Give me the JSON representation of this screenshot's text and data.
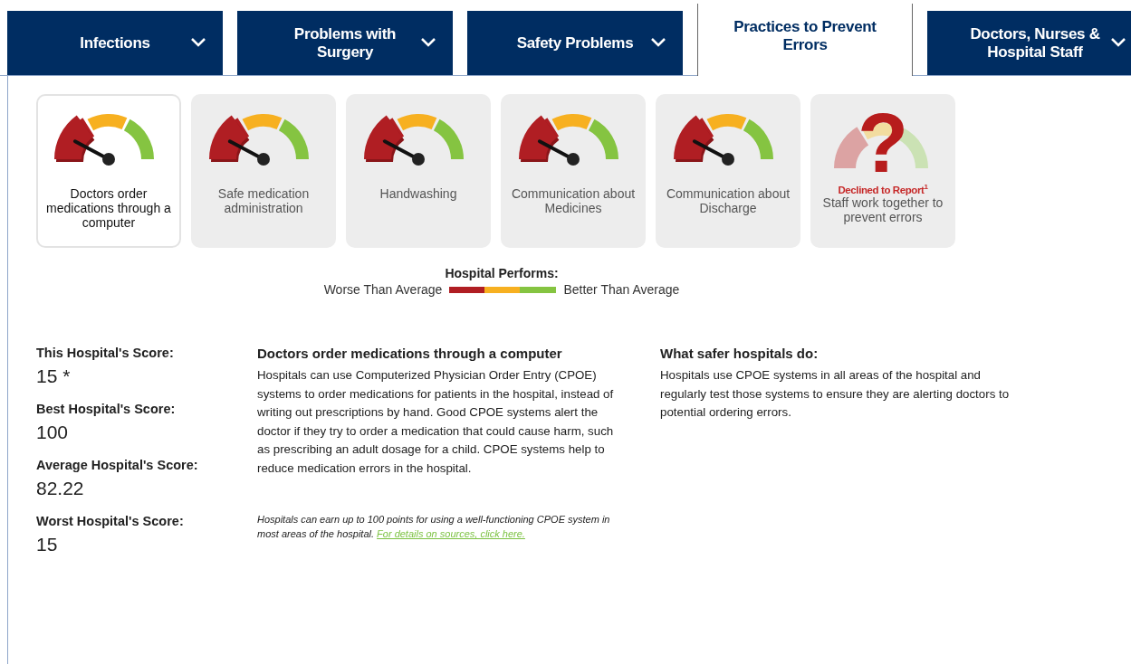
{
  "tabs": [
    {
      "label": "Infections",
      "selected": false
    },
    {
      "label": "Problems with Surgery",
      "selected": false
    },
    {
      "label": "Safety Problems",
      "selected": false
    },
    {
      "label": "Practices to Prevent Errors",
      "selected": true
    },
    {
      "label": "Doctors, Nurses & Hospital Staff",
      "selected": false
    }
  ],
  "measures": [
    {
      "kind": "gauge",
      "label": "Doctors order medications through a computer",
      "selected": true
    },
    {
      "kind": "gauge",
      "label": "Safe medication administration",
      "selected": false
    },
    {
      "kind": "gauge",
      "label": "Handwashing",
      "selected": false
    },
    {
      "kind": "gauge",
      "label": "Communication about Medicines",
      "selected": false
    },
    {
      "kind": "gauge",
      "label": "Communication about Discharge",
      "selected": false
    },
    {
      "kind": "declined",
      "mark": "?",
      "status": "Declined to Report$^{1}$",
      "label": "Staff work together to prevent errors",
      "selected": false
    }
  ],
  "legend": {
    "title": "Hospital Performs:",
    "worse": "Worse Than Average",
    "better": "Better Than Average"
  },
  "scores": [
    {
      "label": "This Hospital's Score:",
      "value": "15 *"
    },
    {
      "label": "Best Hospital's Score:",
      "value": "100"
    },
    {
      "label": "Average Hospital's Score:",
      "value": "82.22"
    },
    {
      "label": "Worst Hospital's Score:",
      "value": "15"
    }
  ],
  "description": {
    "title": "Doctors order medications through a computer",
    "body": "Hospitals can use Computerized Physician Order Entry (CPOE) systems to order medications for patients in the hospital, instead of writing out prescriptions by hand. Good CPOE systems alert the doctor if they try to order a medication that could cause harm, such as prescribing an adult dosage for a child. CPOE systems help to reduce medication errors in the hospital.",
    "note": "Hospitals can earn up to 100 points for using a well-functioning CPOE system in most areas of the hospital.",
    "link": "For details on sources, click here."
  },
  "safer": {
    "title": "What safer hospitals do:",
    "body": "Hospitals use CPOE systems in all areas of the hospital and regularly test those systems to ensure they are alerting doctors to potential ordering errors."
  }
}
